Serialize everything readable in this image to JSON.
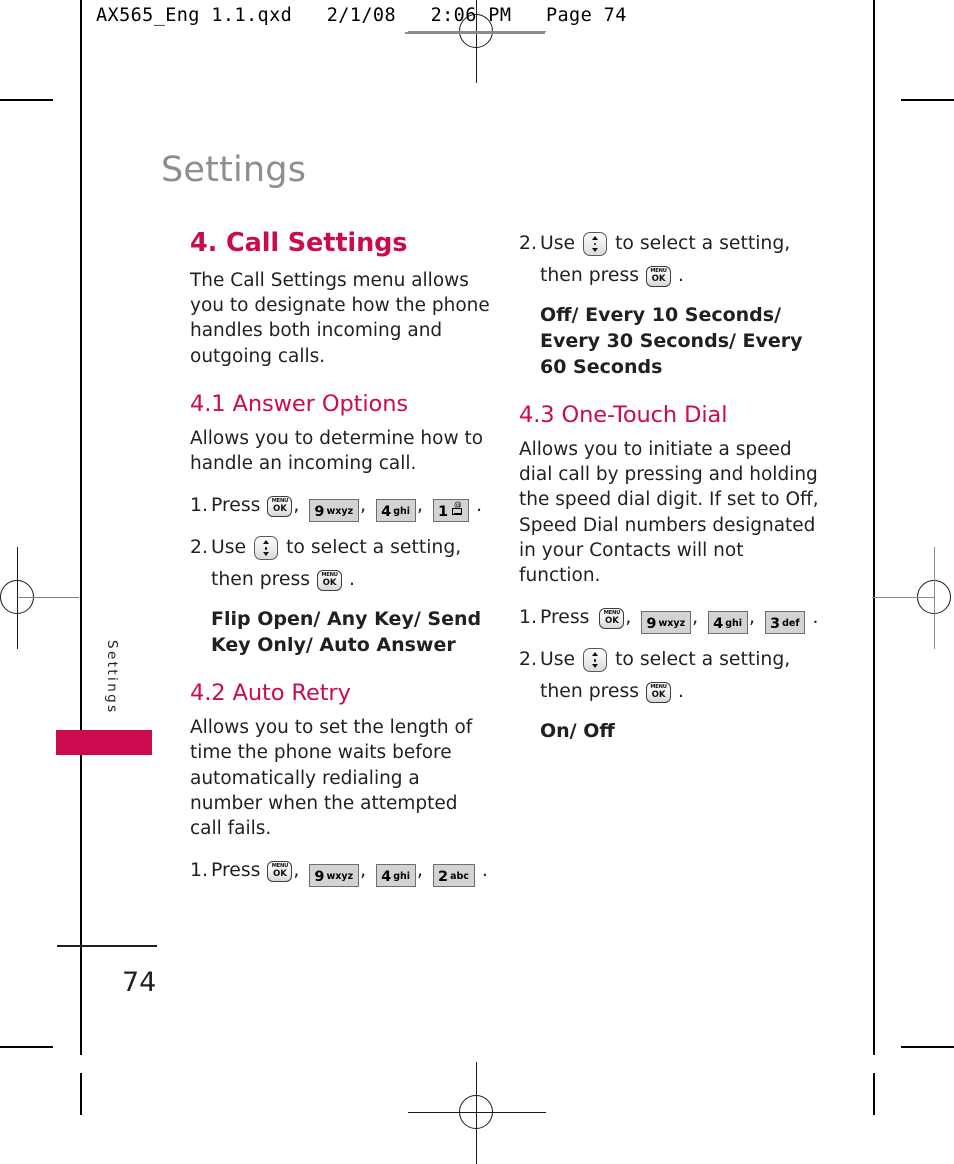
{
  "print_imprint": {
    "text": "AX565_Eng 1.1.qxd   2/1/08   2:06 PM   Page 74"
  },
  "page": {
    "chapter_title": "Settings",
    "side_tab_label": "Settings",
    "page_number": "74",
    "accent_color": "#cc0a50",
    "title_color": "#8e8e8e",
    "body_color": "#231f20"
  },
  "left_column": {
    "section": {
      "heading": "4. Call Settings",
      "intro": "The Call Settings menu allows you to designate how the phone handles both incoming and outgoing calls."
    },
    "sub_41": {
      "heading": "4.1 Answer Options",
      "description": "Allows you to determine how to handle an incoming call.",
      "step1_num": "1.",
      "step1_label": "Press",
      "step1_period": ".",
      "step2_num": "2.",
      "step2_label_a": "Use",
      "step2_label_b": "to select a setting,",
      "step2_label_c": "then press",
      "step2_period": ".",
      "options": "Flip Open/ Any Key/ Send Key Only/ Auto Answer",
      "keys": [
        {
          "type": "menu-ok",
          "top": "MENU",
          "bottom": "OK"
        },
        {
          "type": "digit",
          "digit": "9",
          "letters": "wxyz"
        },
        {
          "type": "digit",
          "digit": "4",
          "letters": "ghi"
        },
        {
          "type": "digit",
          "digit": "1",
          "letters": "",
          "icon": "voicemail-icon"
        }
      ]
    },
    "sub_42": {
      "heading": "4.2 Auto Retry",
      "description": "Allows you to set the length of time the phone waits before automatically redialing a number when the attempted call fails.",
      "step1_num": "1.",
      "step1_label": "Press",
      "step1_period": ".",
      "keys": [
        {
          "type": "menu-ok",
          "top": "MENU",
          "bottom": "OK"
        },
        {
          "type": "digit",
          "digit": "9",
          "letters": "wxyz"
        },
        {
          "type": "digit",
          "digit": "4",
          "letters": "ghi"
        },
        {
          "type": "digit",
          "digit": "2",
          "letters": "abc"
        }
      ]
    }
  },
  "right_column": {
    "sub_42_cont": {
      "step2_num": "2.",
      "step2_label_a": "Use",
      "step2_label_b": "to select a setting,",
      "step2_label_c": "then press",
      "step2_period": ".",
      "options": "Off/ Every 10 Seconds/ Every 30 Seconds/ Every 60 Seconds"
    },
    "sub_43": {
      "heading": "4.3 One-Touch Dial",
      "description": "Allows you to initiate a speed dial call by pressing and holding the speed dial digit. If set to Off, Speed Dial numbers designated in your Contacts will not function.",
      "step1_num": "1.",
      "step1_label": "Press",
      "step1_period": ".",
      "step2_num": "2.",
      "step2_label_a": "Use",
      "step2_label_b": "to select a setting,",
      "step2_label_c": "then press",
      "step2_period": ".",
      "options": "On/ Off",
      "keys": [
        {
          "type": "menu-ok",
          "top": "MENU",
          "bottom": "OK"
        },
        {
          "type": "digit",
          "digit": "9",
          "letters": "wxyz"
        },
        {
          "type": "digit",
          "digit": "4",
          "letters": "ghi"
        },
        {
          "type": "digit",
          "digit": "3",
          "letters": "def"
        }
      ]
    }
  },
  "key_glyph_labels": {
    "menu_top": "MENU",
    "menu_bottom": "OK",
    "nav_name": "navigation-key"
  }
}
